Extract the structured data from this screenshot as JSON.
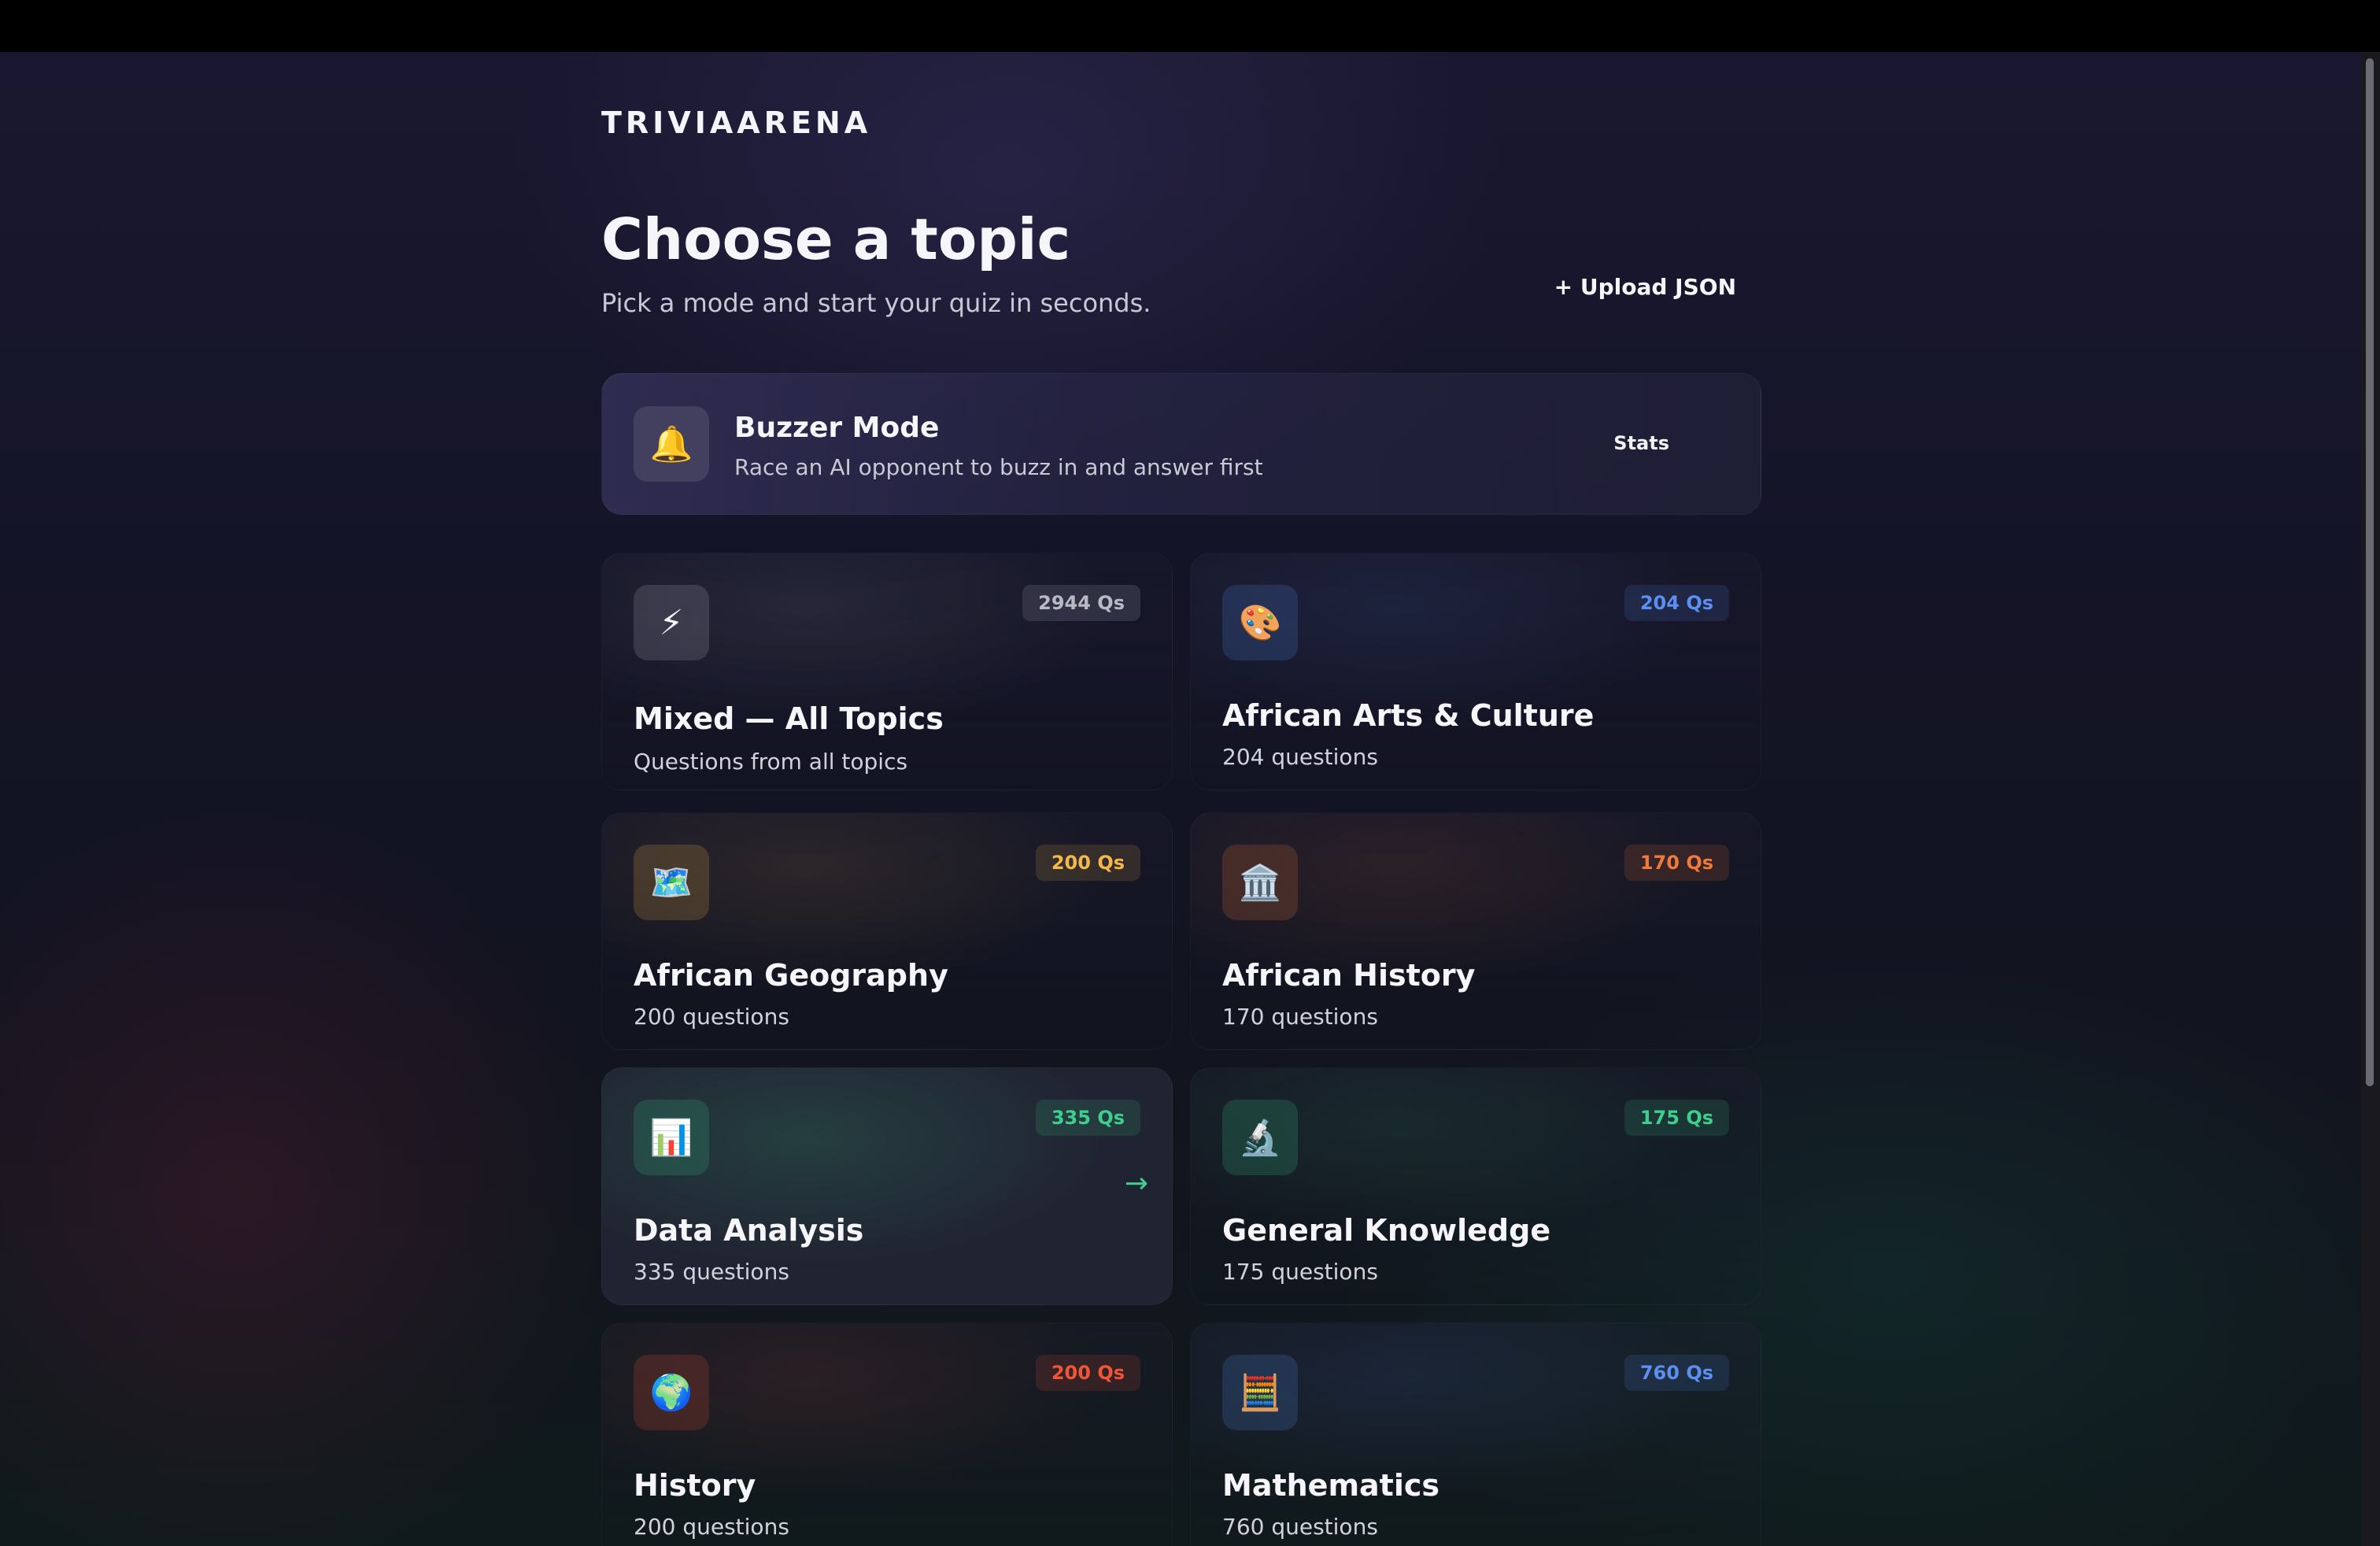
{
  "brand": "TRIVIAARENA",
  "header": {
    "title": "Choose a topic",
    "subtitle": "Pick a mode and start your quiz in seconds.",
    "upload_label": "+ Upload JSON"
  },
  "buzzer": {
    "icon": "bell-icon",
    "icon_glyph": "🔔",
    "title": "Buzzer Mode",
    "description": "Race an AI opponent to buzz in and answer first",
    "stats_label": "Stats"
  },
  "topics": [
    {
      "name": "mixed",
      "icon": "lightning-icon",
      "glyph": "⚡",
      "badge": "2944 Qs",
      "title": "Mixed — All Topics",
      "subtitle": "Questions from all topics",
      "accent": "#b9b9c6"
    },
    {
      "name": "african-arts-culture",
      "icon": "palette-icon",
      "glyph": "🎨",
      "badge": "204 Qs",
      "title": "African Arts & Culture",
      "subtitle": "204 questions",
      "accent": "#5b8ff0"
    },
    {
      "name": "african-geography",
      "icon": "map-icon",
      "glyph": "🗺️",
      "badge": "200 Qs",
      "title": "African Geography",
      "subtitle": "200 questions",
      "accent": "#f2b84b"
    },
    {
      "name": "african-history",
      "icon": "museum-icon",
      "glyph": "🏛️",
      "badge": "170 Qs",
      "title": "African History",
      "subtitle": "170 questions",
      "accent": "#f07a3a"
    },
    {
      "name": "data-analysis",
      "icon": "bar-chart-icon",
      "glyph": "📊",
      "badge": "335 Qs",
      "title": "Data Analysis",
      "subtitle": "335 questions",
      "accent": "#3ecf8e"
    },
    {
      "name": "general-knowledge",
      "icon": "microscope-icon",
      "glyph": "🔬",
      "badge": "175 Qs",
      "title": "General Knowledge",
      "subtitle": "175 questions",
      "accent": "#3ecf8e"
    },
    {
      "name": "history",
      "icon": "globe-icon",
      "glyph": "🌍",
      "badge": "200 Qs",
      "title": "History",
      "subtitle": "200 questions",
      "accent": "#f0553a"
    },
    {
      "name": "mathematics",
      "icon": "abacus-icon",
      "glyph": "🧮",
      "badge": "760 Qs",
      "title": "Mathematics",
      "subtitle": "760 questions",
      "accent": "#5b8ff0"
    }
  ]
}
